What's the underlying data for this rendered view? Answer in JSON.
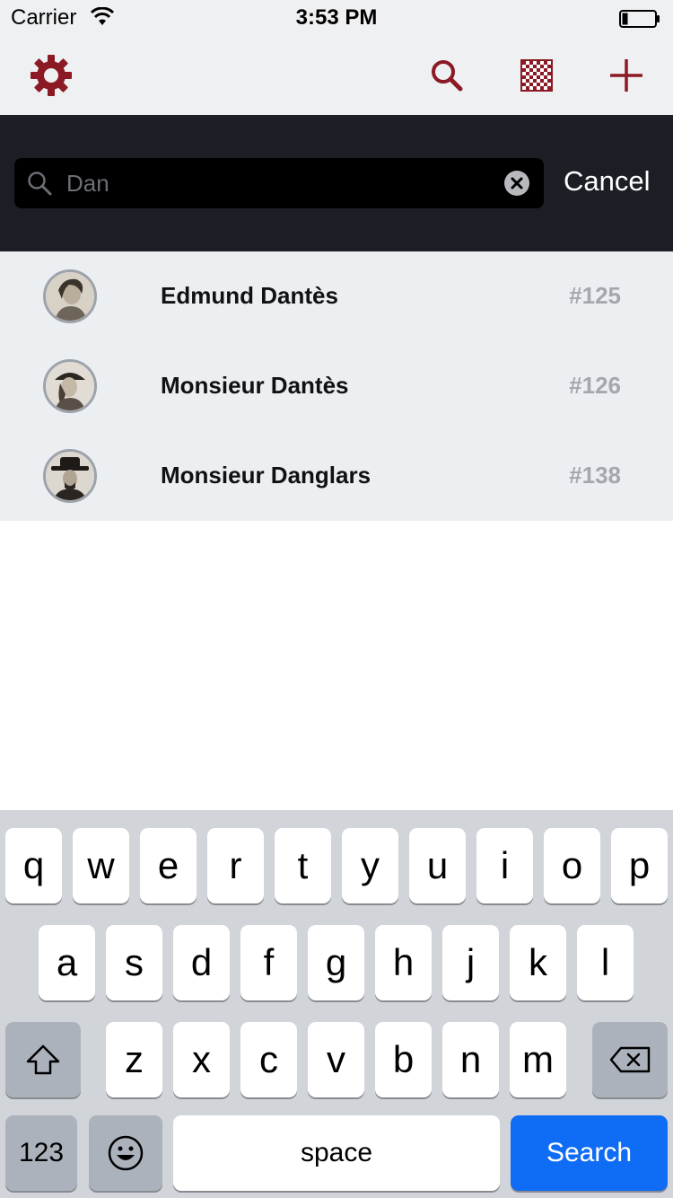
{
  "status_bar": {
    "carrier": "Carrier",
    "time": "3:53 PM"
  },
  "toolbar": {
    "icons": [
      "gear-icon",
      "search-icon",
      "grid-icon",
      "plus-icon"
    ],
    "accent_color": "#8b1a24"
  },
  "search": {
    "query": "Dan",
    "cancel_label": "Cancel"
  },
  "results": [
    {
      "name": "Edmund Dantès",
      "number": "#125"
    },
    {
      "name": "Monsieur Dantès",
      "number": "#126"
    },
    {
      "name": "Monsieur Danglars",
      "number": "#138"
    }
  ],
  "keyboard": {
    "row1": [
      "q",
      "w",
      "e",
      "r",
      "t",
      "y",
      "u",
      "i",
      "o",
      "p"
    ],
    "row2": [
      "a",
      "s",
      "d",
      "f",
      "g",
      "h",
      "j",
      "k",
      "l"
    ],
    "row3": [
      "z",
      "x",
      "c",
      "v",
      "b",
      "n",
      "m"
    ],
    "numbers_label": "123",
    "space_label": "space",
    "search_label": "Search"
  }
}
